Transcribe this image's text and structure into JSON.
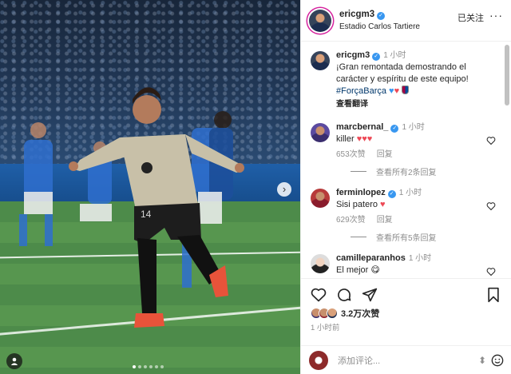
{
  "post": {
    "username": "ericgm3",
    "location": "Estadio Carlos Tartiere",
    "follow_label": "已关注",
    "more_label": "···"
  },
  "caption": {
    "username": "ericgm3",
    "time": "1 小时",
    "text": "¡Gran remontada demostrando el carácter y espíritu de este equipo!",
    "hashtag": "#ForçaBarça",
    "emojis": [
      "blue-heart",
      "red-heart",
      "fc-barcelona-emoji"
    ],
    "translate_label": "查看翻译"
  },
  "comments": [
    {
      "username": "marcbernal_",
      "time": "1 小时",
      "text": "killer",
      "emojis": [
        "red-heart",
        "red-heart",
        "red-heart"
      ],
      "likes": "653次赞",
      "reply_label": "回复",
      "view_replies": "查看所有2条回复"
    },
    {
      "username": "ferminlopez",
      "time": "1 小时",
      "text": "Sisi patero",
      "emojis": [
        "red-heart"
      ],
      "likes": "629次赞",
      "reply_label": "回复",
      "view_replies": "查看所有5条回复"
    },
    {
      "username": "camilleparanhos",
      "time": "1 小时",
      "text": "El mejor",
      "emojis": [
        "face-emoji"
      ]
    }
  ],
  "stats": {
    "likes": "3.2万次赞",
    "time_ago": "1 小时前"
  },
  "add_comment": {
    "placeholder": "添加评论..."
  },
  "photo": {
    "total_slides": 6,
    "current_slide": 1,
    "next_label": "›"
  },
  "colors": {
    "verified": "#3897f0",
    "heart": "#ed4956",
    "link": "#00376b",
    "muted": "#8e8e8e"
  }
}
